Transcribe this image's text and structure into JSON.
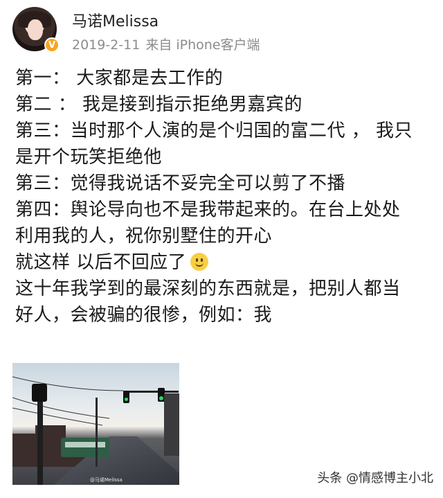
{
  "user": {
    "name": "马诺Melissa",
    "date": "2019-2-11",
    "source": "来自 iPhone客户端",
    "verified_badge": "V"
  },
  "post": {
    "lines": [
      "第一：  大家都是去工作的",
      "第二 ：  我是接到指示拒绝男嘉宾的",
      "第三：当时那个人演的是个归国的富二代 ，  我只",
      "是开个玩笑拒绝他",
      "第三：觉得我说话不妥完全可以剪了不播",
      "第四：舆论导向也不是我带起来的。在台上处处",
      "利用我的人，祝你别墅住的开心",
      "就这样 以后不回应了",
      "这十年我学到的最深刻的东西就是，把别人都当",
      "好人，会被骗的很惨，例如：我"
    ],
    "emoji": "smile-emoji"
  },
  "photo": {
    "watermark": "@马诺Melissa"
  },
  "footer": {
    "credit": "头条 @情感博主小北"
  }
}
